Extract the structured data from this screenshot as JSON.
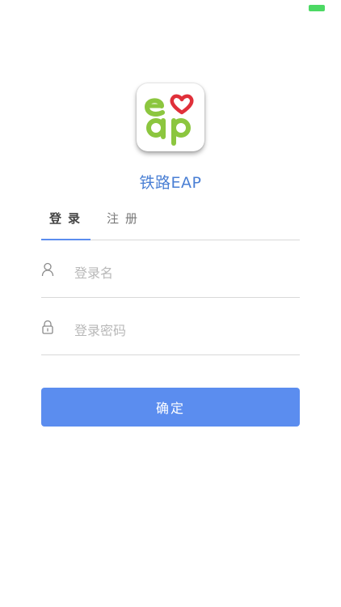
{
  "app": {
    "title": "铁路EAP",
    "logo_text_top": "e",
    "logo_text_bottom": "ap",
    "brand_color": "#4a7fd4",
    "logo_green": "#8cc63f",
    "logo_heart": "#e0303a"
  },
  "tabs": [
    {
      "label": "登录",
      "active": true
    },
    {
      "label": "注册",
      "active": false
    }
  ],
  "form": {
    "username_placeholder": "登录名",
    "username_value": "",
    "password_placeholder": "登录密码",
    "password_value": "",
    "submit_label": "确定"
  },
  "icons": {
    "username": "user-icon",
    "password": "lock-icon"
  },
  "colors": {
    "accent": "#5b8def",
    "battery": "#4cd964"
  }
}
